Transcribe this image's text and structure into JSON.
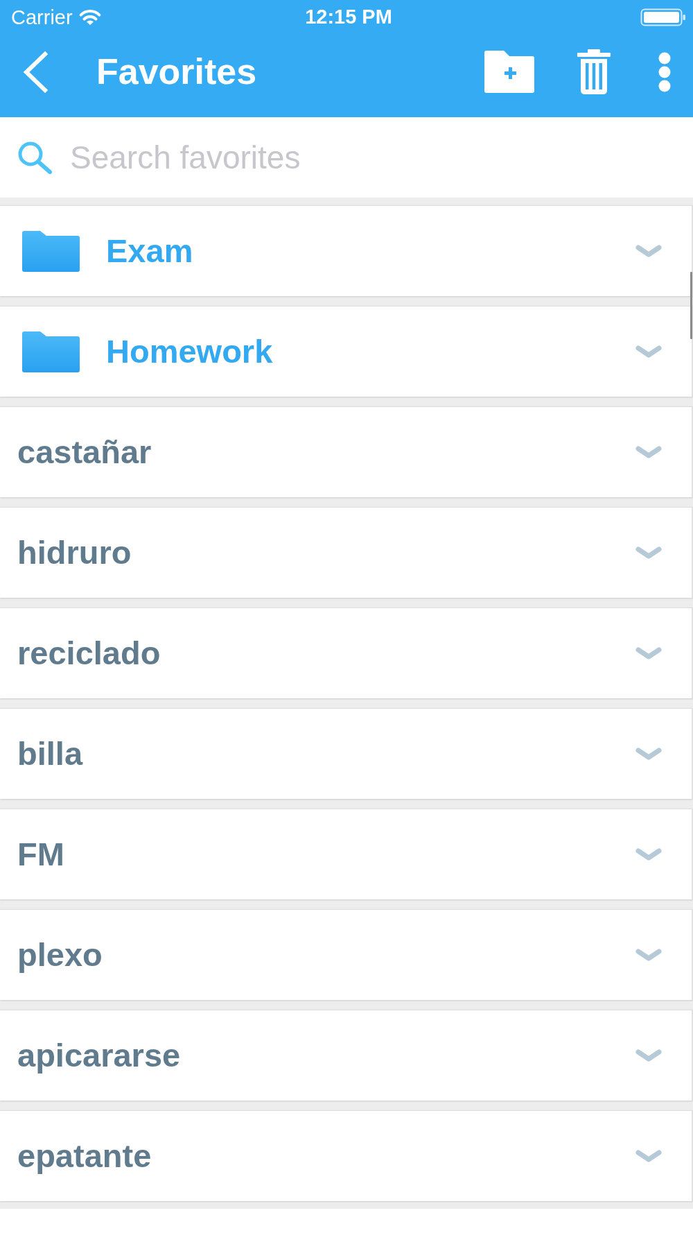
{
  "status_bar": {
    "carrier": "Carrier",
    "time": "12:15 PM"
  },
  "header": {
    "title": "Favorites"
  },
  "search": {
    "placeholder": "Search favorites"
  },
  "items": [
    {
      "kind": "folder",
      "label": "Exam"
    },
    {
      "kind": "folder",
      "label": "Homework"
    },
    {
      "kind": "word",
      "label": "castañar"
    },
    {
      "kind": "word",
      "label": "hidruro"
    },
    {
      "kind": "word",
      "label": "reciclado"
    },
    {
      "kind": "word",
      "label": "billa"
    },
    {
      "kind": "word",
      "label": "FM"
    },
    {
      "kind": "word",
      "label": "plexo"
    },
    {
      "kind": "word",
      "label": "apicararse"
    },
    {
      "kind": "word",
      "label": "epatante"
    }
  ]
}
